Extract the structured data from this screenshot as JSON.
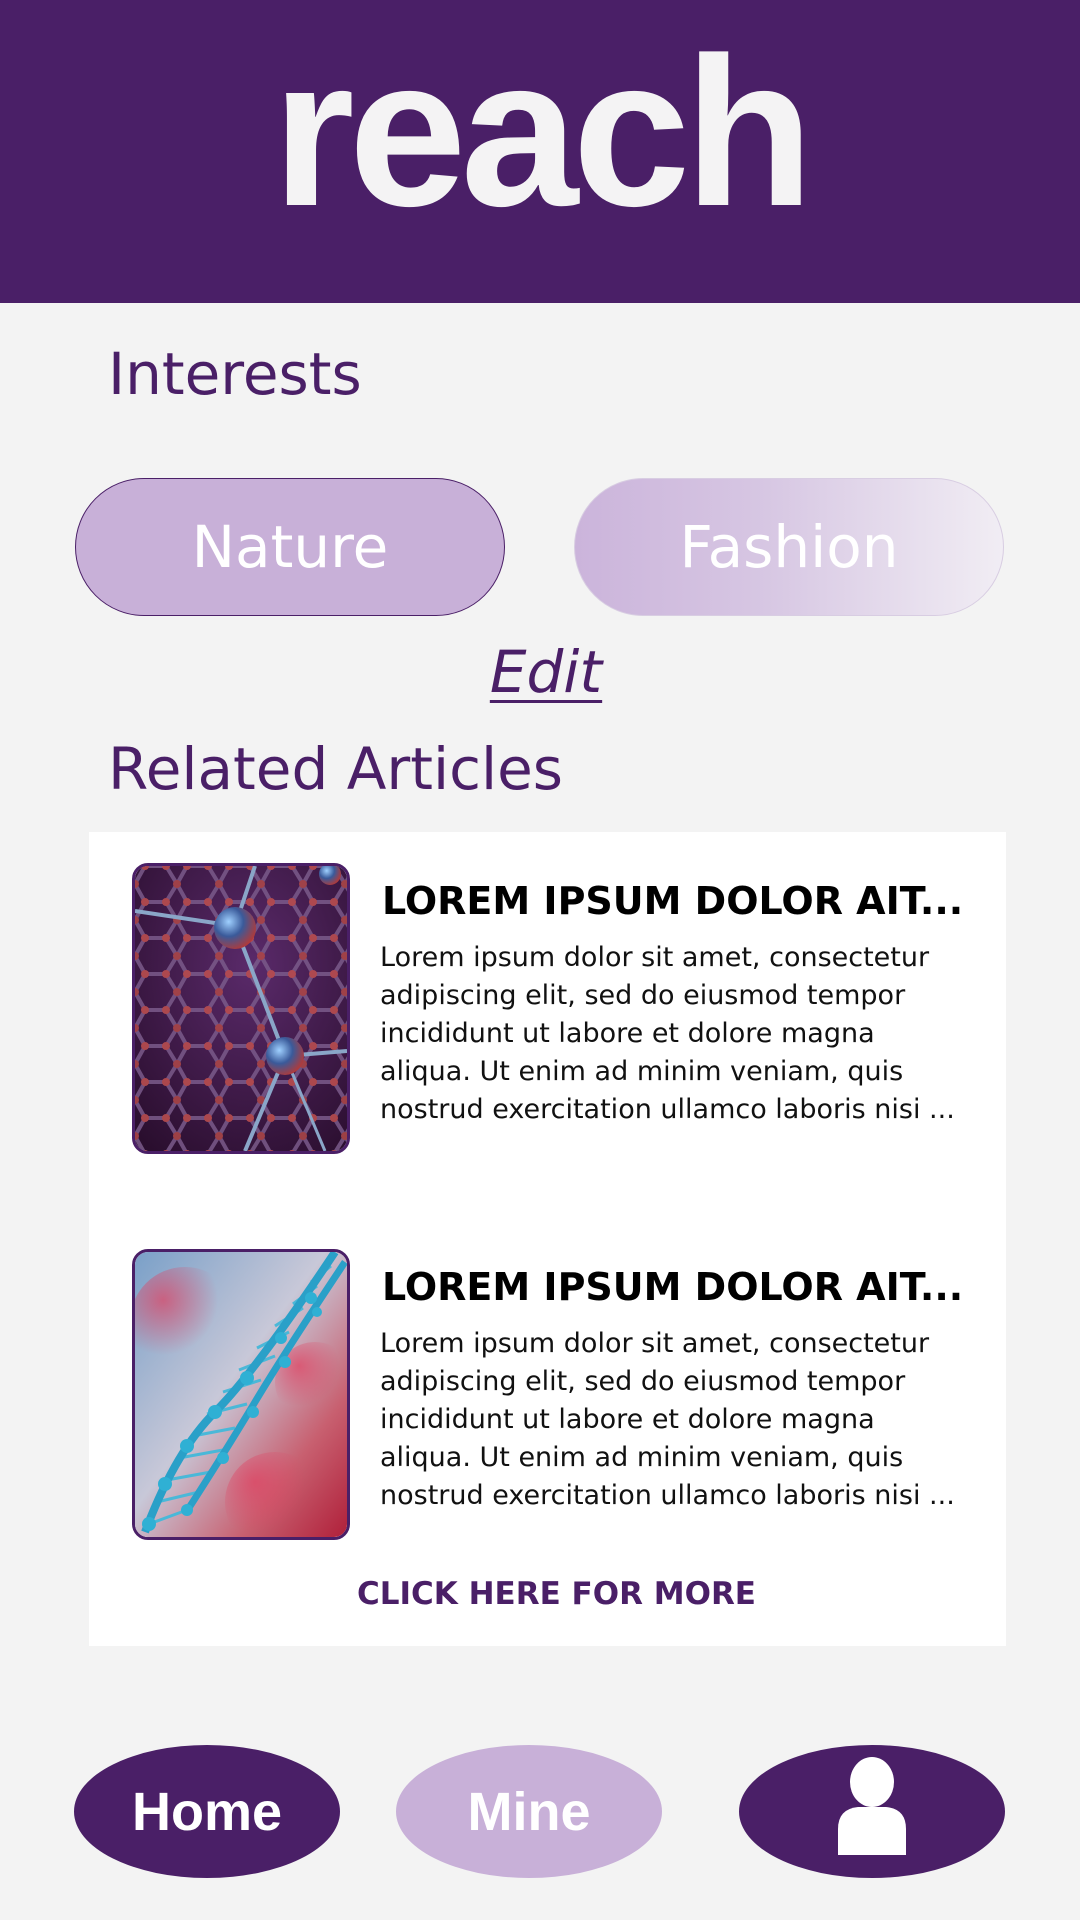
{
  "header": {
    "logo": "reach",
    "brand_color": "#4a1f67"
  },
  "interests": {
    "title": "Interests",
    "chips": [
      {
        "label": "Nature"
      },
      {
        "label": "Fashion"
      }
    ],
    "edit_label": "Edit"
  },
  "related": {
    "title": "Related Articles",
    "articles": [
      {
        "title": "LOREM IPSUM DOLOR AIT...",
        "body": "Lorem ipsum dolor sit amet, consectetur adipiscing elit, sed do eiusmod tempor incididunt ut labore et dolore magna aliqua. Ut enim ad minim veniam, quis nostrud exercitation ullamco laboris nisi ...",
        "image": "molecule-lattice-image"
      },
      {
        "title": "LOREM IPSUM DOLOR AIT...",
        "body": "Lorem ipsum dolor sit amet, consectetur adipiscing elit, sed do eiusmod tempor incididunt ut labore et dolore magna aliqua. Ut enim ad minim veniam, quis nostrud exercitation ullamco laboris nisi ...",
        "image": "dna-helix-image"
      }
    ],
    "more_label": "CLICK HERE FOR MORE"
  },
  "nav": {
    "home_label": "Home",
    "mine_label": "Mine",
    "profile_icon": "user-icon"
  }
}
